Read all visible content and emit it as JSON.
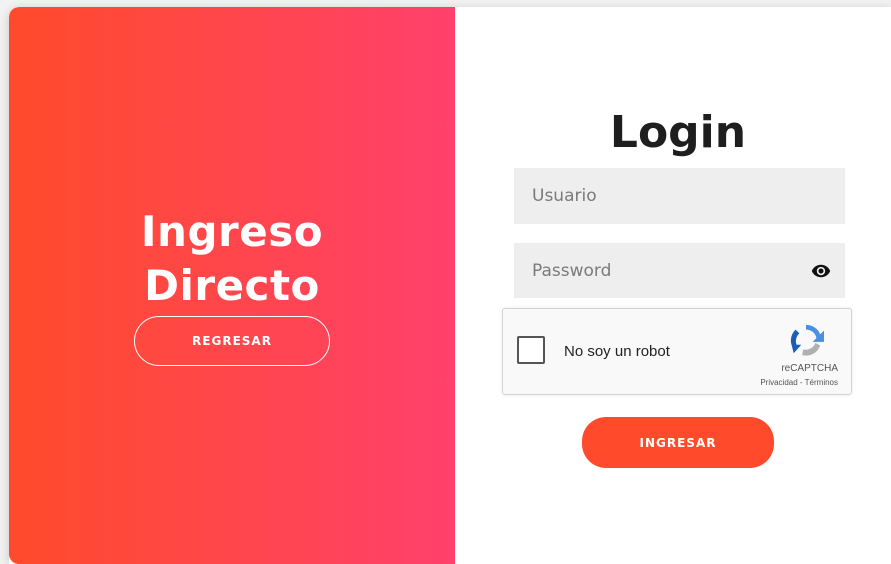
{
  "overlay": {
    "title_line1": "Ingreso",
    "title_line2": "Directo",
    "back_button": "REGRESAR"
  },
  "login": {
    "title": "Login",
    "username_placeholder": "Usuario",
    "password_placeholder": "Password",
    "password_toggle_icon": "eye-icon",
    "submit_button": "INGRESAR"
  },
  "recaptcha": {
    "label": "No soy un robot",
    "brand": "reCAPTCHA",
    "privacy_link": "Privacidad",
    "separator": " - ",
    "terms_link": "Términos",
    "checked": false
  },
  "colors": {
    "gradient_start": "#ff4b2b",
    "gradient_end": "#ff416c",
    "input_bg": "#eeeeee",
    "title_text": "#1e1e1e"
  }
}
